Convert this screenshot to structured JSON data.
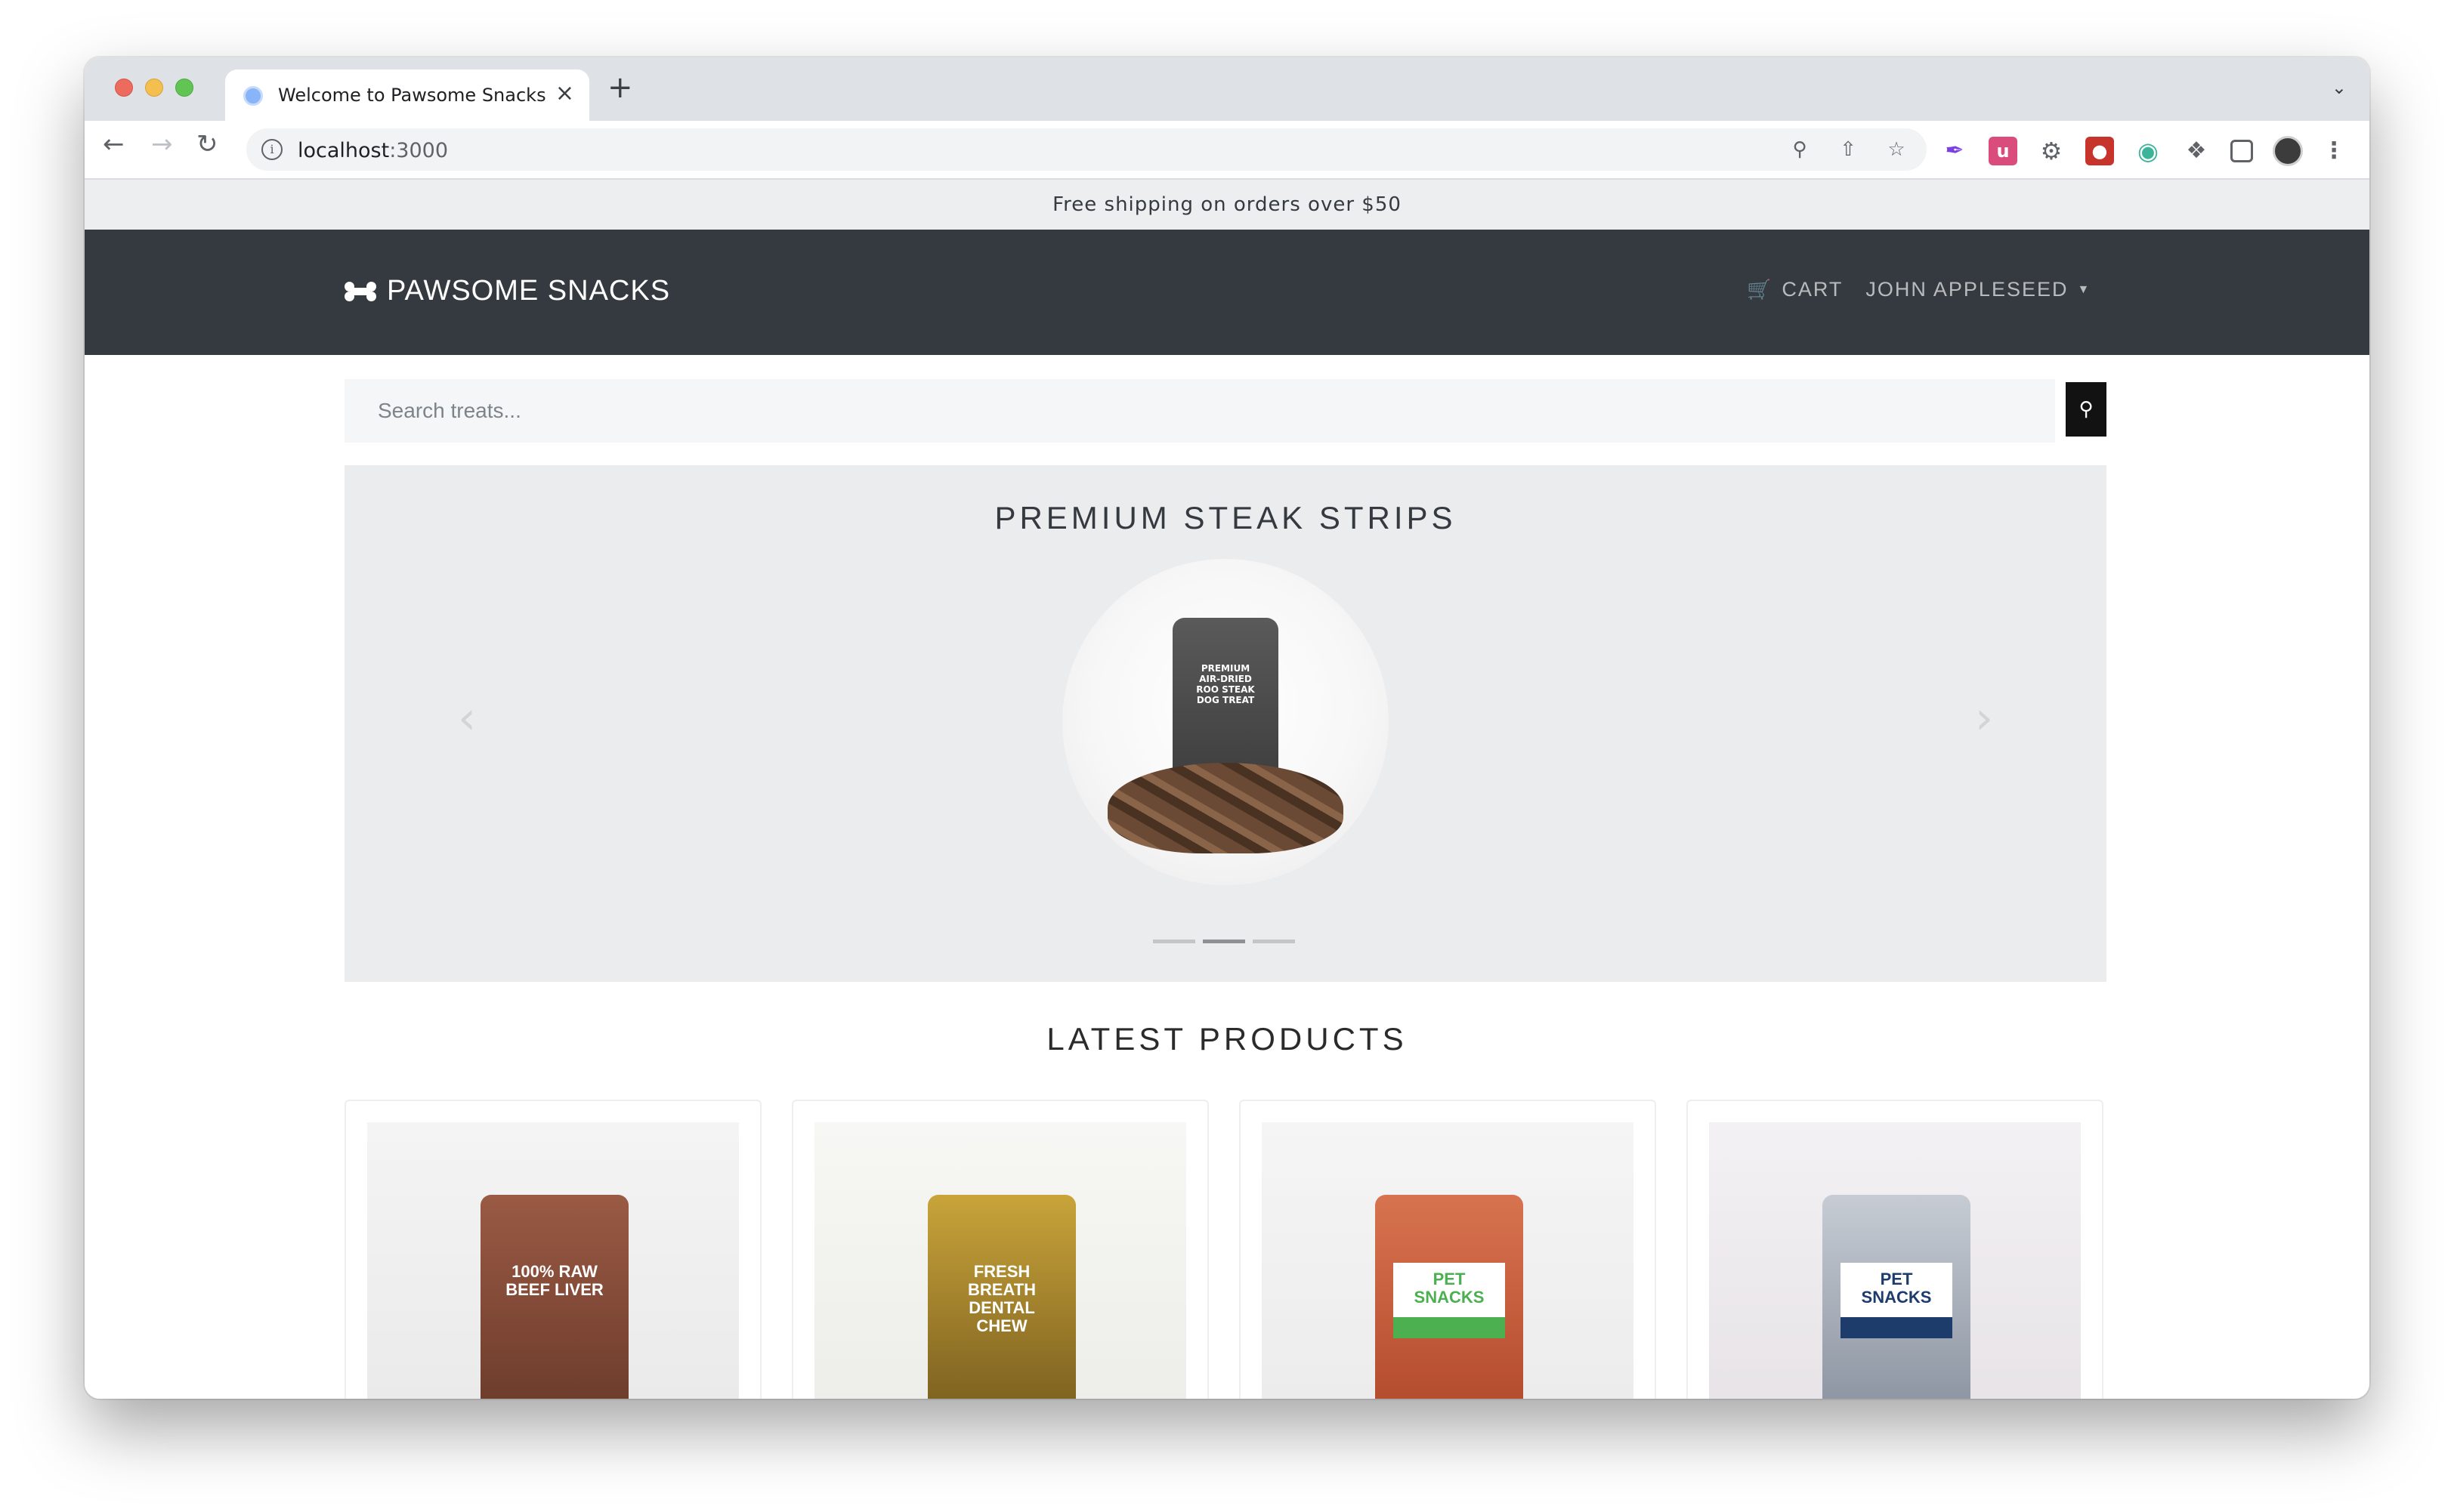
{
  "browser": {
    "tab_title": "Welcome to Pawsome Snacks",
    "url_host": "localhost",
    "url_port": ":3000",
    "new_tab_symbol": "+",
    "close_symbol": "×"
  },
  "announcement": "Free shipping on orders over $50",
  "navbar": {
    "brand": "PAWSOME SNACKS",
    "cart_label": "CART",
    "user_label": "JOHN APPLESEED"
  },
  "search": {
    "placeholder": "Search treats..."
  },
  "carousel": {
    "title": "PREMIUM STEAK STRIPS",
    "image_label": "PREMIUM AIR-DRIED ROO STEAK DOG TREAT",
    "active_index": 2,
    "slide_count": 3
  },
  "latest": {
    "title": "LATEST PRODUCTS",
    "products": [
      {
        "label": "100% RAW BEEF LIVER"
      },
      {
        "label": "FRESH BREATH DENTAL CHEW"
      },
      {
        "label": "PET SNACKS"
      },
      {
        "label": "PET SNACKS"
      }
    ]
  },
  "colors": {
    "navbar_bg": "#343a40",
    "announce_bg": "#eceef0",
    "carousel_bg": "#ebecee",
    "search_btn": "#121212"
  }
}
